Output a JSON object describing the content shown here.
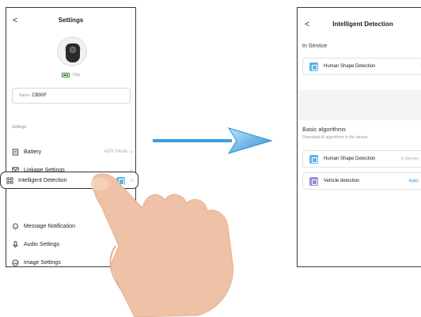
{
  "left": {
    "title": "Settings",
    "back": "<",
    "battery_pct": "73%",
    "name_label": "Name",
    "name_value": "CB90F",
    "section": "Settings",
    "rows": [
      {
        "label": "Battery",
        "value": "AOV Mode",
        "chev": ">"
      },
      {
        "label": "Linkage Settings",
        "value": "",
        "chev": ">"
      },
      {
        "label": "Intelligent Detection",
        "value": "",
        "chev": ">"
      },
      {
        "label": "Message Notification",
        "value": "",
        "chev": ""
      },
      {
        "label": "Audio Settings",
        "value": "",
        "chev": ""
      },
      {
        "label": "Image Settings",
        "value": "",
        "chev": ""
      }
    ]
  },
  "right": {
    "title": "Intelligent Detection",
    "back": "<",
    "in_service_heading": "In Service",
    "in_service_card": {
      "label": "Human Shape Detection",
      "chev": ">"
    },
    "basic_heading": "Basic algorithms",
    "basic_sub": "Download AI algorithms to the device.",
    "algorithms": [
      {
        "label": "Human Shape Detection",
        "status": "In Service"
      },
      {
        "label": "Vehicle detection",
        "status": "Apply"
      }
    ]
  },
  "colors": {
    "accent_blue": "#5db4e8",
    "arrow_blue": "#3a9fdc",
    "purple": "#9d8bd6",
    "skin": "#efc1a6"
  }
}
